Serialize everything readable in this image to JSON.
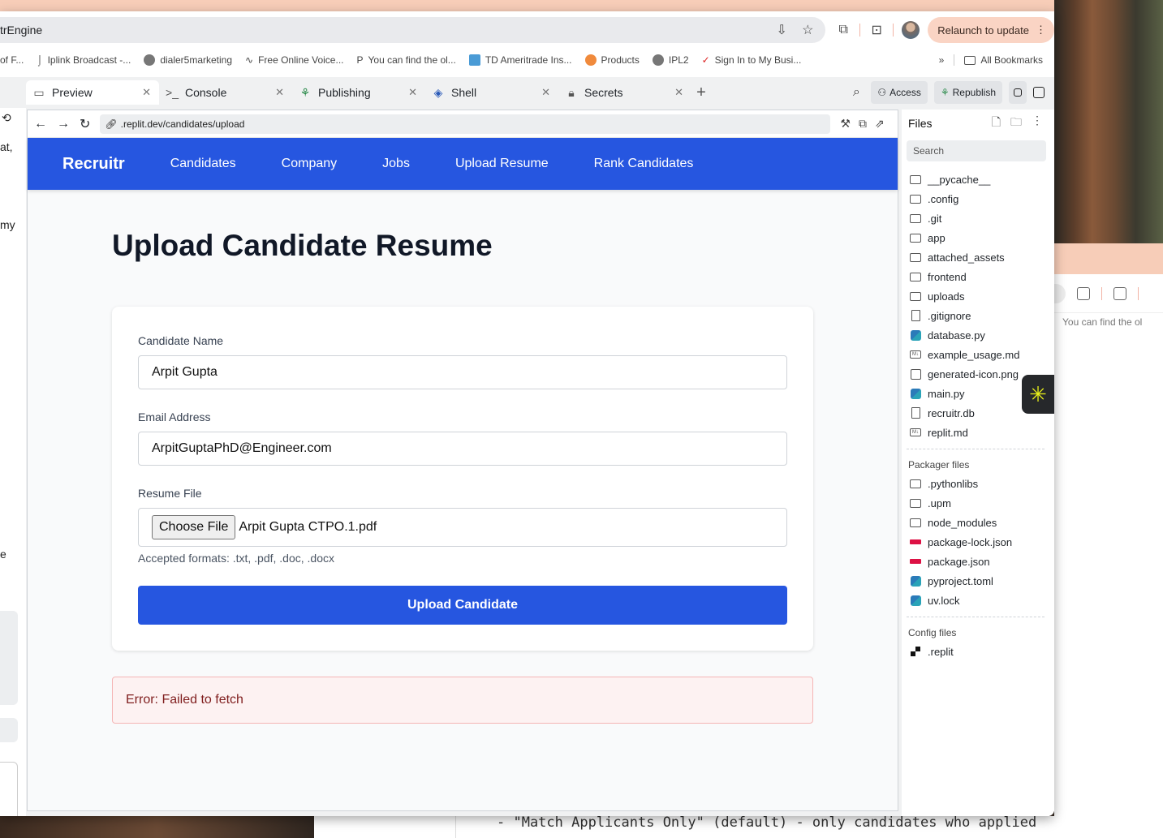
{
  "window": {
    "app_title": "trEngine",
    "relaunch_label": "Relaunch to update"
  },
  "bookmarks": {
    "items": [
      {
        "label": "of F...",
        "icon": "folder-icon"
      },
      {
        "label": "Iplink Broadcast -...",
        "icon": "iplink-icon"
      },
      {
        "label": "dialer5marketing",
        "icon": "globe-icon"
      },
      {
        "label": "Free Online Voice...",
        "icon": "wave-icon"
      },
      {
        "label": "You can find the ol...",
        "icon": "p-icon"
      },
      {
        "label": "TD Ameritrade Ins...",
        "icon": "td-icon"
      },
      {
        "label": "Products",
        "icon": "products-icon"
      },
      {
        "label": "IPL2",
        "icon": "globe-icon"
      },
      {
        "label": "Sign In to My Busi...",
        "icon": "check-icon"
      }
    ],
    "all_label": "All Bookmarks"
  },
  "replit": {
    "tabs": [
      {
        "label": "Preview",
        "icon": "monitor-icon",
        "active": true
      },
      {
        "label": "Console",
        "icon": "terminal-icon",
        "active": false
      },
      {
        "label": "Publishing",
        "icon": "publish-icon",
        "active": false
      },
      {
        "label": "Shell",
        "icon": "shell-icon",
        "active": false
      },
      {
        "label": "Secrets",
        "icon": "lock-icon",
        "active": false
      }
    ],
    "access_label": "Access",
    "republish_label": "Republish",
    "preview_url": ".replit.dev/candidates/upload"
  },
  "left_pane": {
    "snippets": [
      "at,",
      "my",
      "e"
    ]
  },
  "site": {
    "brand": "Recruitr",
    "nav": [
      "Candidates",
      "Company",
      "Jobs",
      "Upload Resume",
      "Rank Candidates"
    ],
    "page_title": "Upload Candidate Resume",
    "form": {
      "name_label": "Candidate Name",
      "name_value": "Arpit Gupta",
      "email_label": "Email Address",
      "email_value": "ArpitGuptaPhD@Engineer.com",
      "resume_label": "Resume File",
      "choose_label": "Choose File",
      "file_name": "Arpit Gupta CTPO.1.pdf",
      "hint": "Accepted formats: .txt, .pdf, .doc, .docx",
      "submit_label": "Upload Candidate"
    },
    "error": "Error: Failed to fetch"
  },
  "files": {
    "title": "Files",
    "search_placeholder": "Search",
    "items": [
      {
        "name": "__pycache__",
        "type": "folder"
      },
      {
        "name": ".config",
        "type": "folder"
      },
      {
        "name": ".git",
        "type": "folder"
      },
      {
        "name": "app",
        "type": "folder"
      },
      {
        "name": "attached_assets",
        "type": "folder"
      },
      {
        "name": "frontend",
        "type": "folder"
      },
      {
        "name": "uploads",
        "type": "folder"
      },
      {
        "name": ".gitignore",
        "type": "doc"
      },
      {
        "name": "database.py",
        "type": "py"
      },
      {
        "name": "example_usage.md",
        "type": "md"
      },
      {
        "name": "generated-icon.png",
        "type": "img"
      },
      {
        "name": "main.py",
        "type": "py"
      },
      {
        "name": "recruitr.db",
        "type": "doc"
      },
      {
        "name": "replit.md",
        "type": "md"
      }
    ],
    "packager_title": "Packager files",
    "packager_items": [
      {
        "name": ".pythonlibs",
        "type": "folder"
      },
      {
        "name": ".upm",
        "type": "folder"
      },
      {
        "name": "node_modules",
        "type": "folder"
      },
      {
        "name": "package-lock.json",
        "type": "npm"
      },
      {
        "name": "package.json",
        "type": "npm"
      },
      {
        "name": "pyproject.toml",
        "type": "py"
      },
      {
        "name": "uv.lock",
        "type": "py"
      }
    ],
    "config_title": "Config files",
    "config_items": [
      {
        "name": ".replit",
        "type": "rep"
      }
    ]
  },
  "background": {
    "back_window_bookmark": "You can find the ol",
    "terminal_line": "- \"Match Applicants Only\" (default) - only candidates who applied"
  }
}
